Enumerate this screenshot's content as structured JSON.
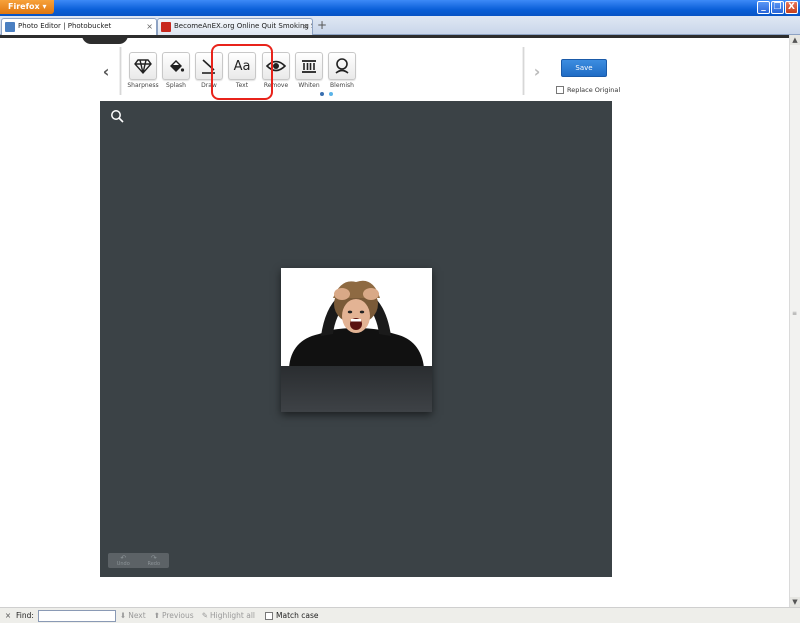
{
  "browser": {
    "menu_button": "Firefox",
    "tabs": [
      {
        "label": "Photo Editor | Photobucket",
        "close": "×"
      },
      {
        "label": "BecomeAnEX.org Online Quit Smoking Su...",
        "close": "×"
      }
    ],
    "new_tab": "+"
  },
  "window_controls": {
    "minimize": "_",
    "restore": "❐",
    "close": "X"
  },
  "toolbar": {
    "prev_arrow": "‹",
    "next_arrow": "›",
    "tools": [
      {
        "label": "Sharpness",
        "icon": "diamond-icon"
      },
      {
        "label": "Splash",
        "icon": "paint-bucket-icon"
      },
      {
        "label": "Draw",
        "icon": "brush-icon"
      },
      {
        "label": "Text",
        "icon": "text-aa-icon",
        "glyph": "Aa"
      },
      {
        "label": "Remove",
        "icon": "eye-icon"
      },
      {
        "label": "Whiten",
        "icon": "teeth-icon"
      },
      {
        "label": "Blemish",
        "icon": "face-icon"
      }
    ]
  },
  "save_label": "Save",
  "replace_original_label": "Replace Original",
  "canvas": {
    "undo_label": "Undo",
    "redo_label": "Redo"
  },
  "findbar": {
    "close": "×",
    "find_label": "Find:",
    "find_value": "",
    "next_label": "Next",
    "previous_label": "Previous",
    "highlight_label": "Highlight all",
    "match_case_label": "Match case"
  },
  "colors": {
    "canvas_bg": "#3b4246",
    "accent_blue": "#1f6cc5",
    "highlight_red": "#e8231b"
  }
}
